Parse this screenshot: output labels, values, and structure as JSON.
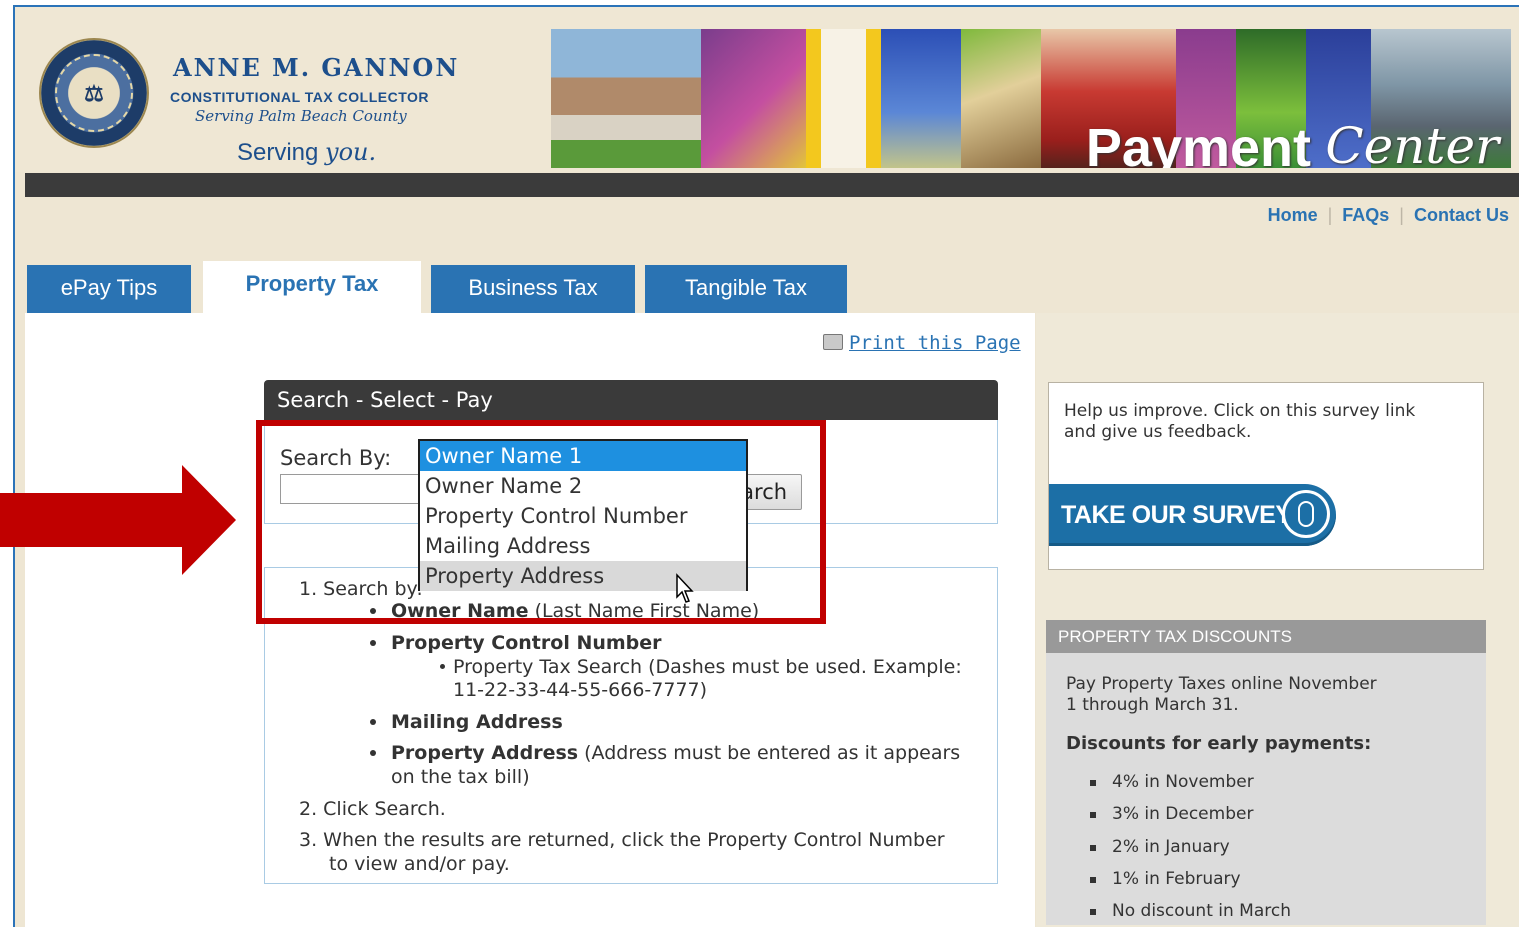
{
  "header": {
    "name": "ANNE M. GANNON",
    "title_line": "CONSTITUTIONAL TAX COLLECTOR",
    "subtitle": "Serving Palm Beach County",
    "tagline_a": "Serving",
    "tagline_b": "you.",
    "banner_word_1": "Payment",
    "banner_word_2": "Center"
  },
  "top_nav": {
    "home": "Home",
    "faqs": "FAQs",
    "contact": "Contact Us"
  },
  "tabs": [
    {
      "label": "ePay Tips"
    },
    {
      "label": "Property Tax"
    },
    {
      "label": "Business Tax"
    },
    {
      "label": "Tangible Tax"
    }
  ],
  "print_link": "Print this Page",
  "search_panel": {
    "title": "Search - Select - Pay",
    "search_by_label": "Search By:",
    "button_label": "Search",
    "options": [
      "Owner Name 1",
      "Owner Name 2",
      "Property Control Number",
      "Mailing Address",
      "Property Address"
    ],
    "selected": "Owner Name 1",
    "hovered": "Property Address"
  },
  "instructions": {
    "step1_a": "1. Search by:",
    "owner_name_bold": "Owner Name",
    "owner_name_rest": "(Last Name First Name)",
    "pcn_bold": "Property Control Number",
    "pcn_sub_1": "Property Tax Search (Dashes must be used. Example:",
    "pcn_sub_2": "11-22-33-44-55-666-7777)",
    "mailing_bold": "Mailing Address",
    "prop_bold": "Property Address",
    "prop_rest_1": "(Address must be entered as it appears",
    "prop_rest_2": "on the tax bill)",
    "step2": "2. Click Search.",
    "step3_1": "3. When the results are returned, click the Property Control Number",
    "step3_2": "to view and/or pay."
  },
  "sidebar": {
    "survey_text_1": "Help us improve. Click on this survey link",
    "survey_text_2": "and give us feedback.",
    "survey_button": "TAKE OUR SURVEY",
    "discounts_title": "PROPERTY TAX DISCOUNTS",
    "discounts_intro_1": "Pay Property Taxes online November",
    "discounts_intro_2": "1 through March 31.",
    "discounts_heading": "Discounts for early payments:",
    "discounts": [
      "4% in November",
      "3% in December",
      "2% in January",
      "1% in February",
      "No discount in March"
    ]
  },
  "colors": {
    "accent": "#2a73b3",
    "highlight": "#c00000",
    "selected_option": "#1e90e0"
  }
}
